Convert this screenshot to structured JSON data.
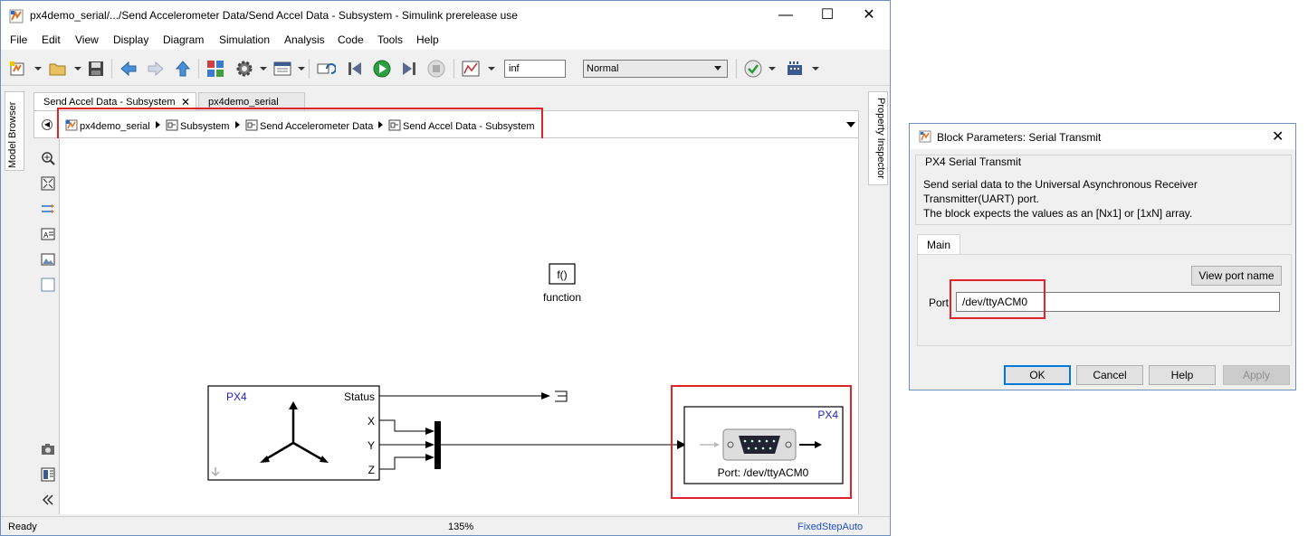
{
  "window": {
    "title": "px4demo_serial/.../Send Accelerometer Data/Send Accel Data - Subsystem - Simulink prerelease use",
    "minimize": "—",
    "maximize": "☐",
    "close": "✕"
  },
  "menu": [
    "File",
    "Edit",
    "View",
    "Display",
    "Diagram",
    "Simulation",
    "Analysis",
    "Code",
    "Tools",
    "Help"
  ],
  "toolbar": {
    "stop_time": "inf",
    "sim_mode": "Normal"
  },
  "side_tabs": {
    "model_browser": "Model Browser",
    "property_inspector": "Property Inspector"
  },
  "tabs": [
    {
      "label": "Send Accel Data - Subsystem",
      "close": "✕"
    },
    {
      "label": "px4demo_serial"
    }
  ],
  "breadcrumb": [
    "px4demo_serial",
    "Subsystem",
    "Send Accelerometer Data",
    "Send Accel Data - Subsystem"
  ],
  "canvas": {
    "function_block": {
      "icon_text": "f()",
      "label": "function"
    },
    "accel_block": {
      "brand": "PX4",
      "ports": [
        "Status",
        "X",
        "Y",
        "Z"
      ]
    },
    "serial_block": {
      "brand": "PX4",
      "port_text": "Port: /dev/ttyACM0"
    }
  },
  "status": {
    "left": "Ready",
    "zoom": "135%",
    "solver": "FixedStepAuto"
  },
  "dialog": {
    "title": "Block Parameters: Serial Transmit",
    "close": "✕",
    "group_title": "PX4 Serial Transmit",
    "description": [
      "Send serial data to the Universal Asynchronous Receiver",
      "Transmitter(UART) port.",
      "The block expects the values as an [Nx1] or [1xN] array."
    ],
    "tab": "Main",
    "view_port_button": "View port name",
    "port_label": "Port:",
    "port_value": "/dev/ttyACM0",
    "buttons": {
      "ok": "OK",
      "cancel": "Cancel",
      "help": "Help",
      "apply": "Apply"
    }
  },
  "colors": {
    "highlight": "#e0242b",
    "px4_brand": "#1f1fbf",
    "window_border": "#6b8fbf"
  }
}
